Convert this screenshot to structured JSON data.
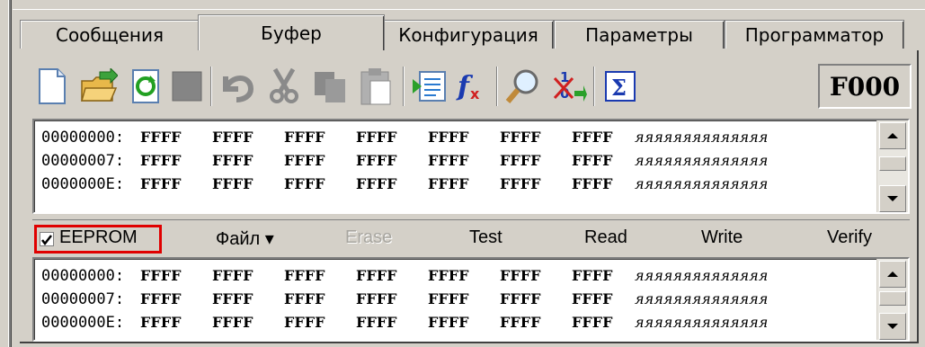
{
  "tabs": [
    {
      "label": "Сообщения",
      "active": false
    },
    {
      "label": "Буфер",
      "active": true
    },
    {
      "label": "Конфигурация",
      "active": false
    },
    {
      "label": "Параметры",
      "active": false
    },
    {
      "label": "Программатор",
      "active": false
    }
  ],
  "toolbar": {
    "icons": [
      "new-file-icon",
      "open-folder-icon",
      "refresh-icon",
      "stop-icon",
      "undo-icon",
      "cut-icon",
      "copy-icon",
      "paste-icon",
      "load-buffer-icon",
      "function-icon",
      "find-icon",
      "fill-icon",
      "checksum-icon"
    ],
    "checksum_value": "F000"
  },
  "buffer_view": {
    "rows": [
      {
        "addr": "00000000:",
        "words": [
          "FFFF",
          "FFFF",
          "FFFF",
          "FFFF",
          "FFFF",
          "FFFF",
          "FFFF"
        ],
        "ascii": "яяяяяяяяяяяяяя"
      },
      {
        "addr": "00000007:",
        "words": [
          "FFFF",
          "FFFF",
          "FFFF",
          "FFFF",
          "FFFF",
          "FFFF",
          "FFFF"
        ],
        "ascii": "яяяяяяяяяяяяяя"
      },
      {
        "addr": "0000000E:",
        "words": [
          "FFFF",
          "FFFF",
          "FFFF",
          "FFFF",
          "FFFF",
          "FFFF",
          "FFFF"
        ],
        "ascii": "яяяяяяяяяяяяяя"
      }
    ]
  },
  "eeprom_bar": {
    "checkbox_label": "EEPROM",
    "checked": true,
    "file_menu": "Файл ▾",
    "erase": "Erase",
    "test": "Test",
    "read": "Read",
    "write": "Write",
    "verify": "Verify"
  },
  "eeprom_view": {
    "rows": [
      {
        "addr": "00000000:",
        "words": [
          "FFFF",
          "FFFF",
          "FFFF",
          "FFFF",
          "FFFF",
          "FFFF",
          "FFFF"
        ],
        "ascii": "яяяяяяяяяяяяяя"
      },
      {
        "addr": "00000007:",
        "words": [
          "FFFF",
          "FFFF",
          "FFFF",
          "FFFF",
          "FFFF",
          "FFFF",
          "FFFF"
        ],
        "ascii": "яяяяяяяяяяяяяя"
      },
      {
        "addr": "0000000E:",
        "words": [
          "FFFF",
          "FFFF",
          "FFFF",
          "FFFF",
          "FFFF",
          "FFFF",
          "FFFF"
        ],
        "ascii": "яяяяяяяяяяяяяя"
      }
    ]
  },
  "colors": {
    "highlight_border": "#e00000",
    "face": "#d4d0c8"
  }
}
